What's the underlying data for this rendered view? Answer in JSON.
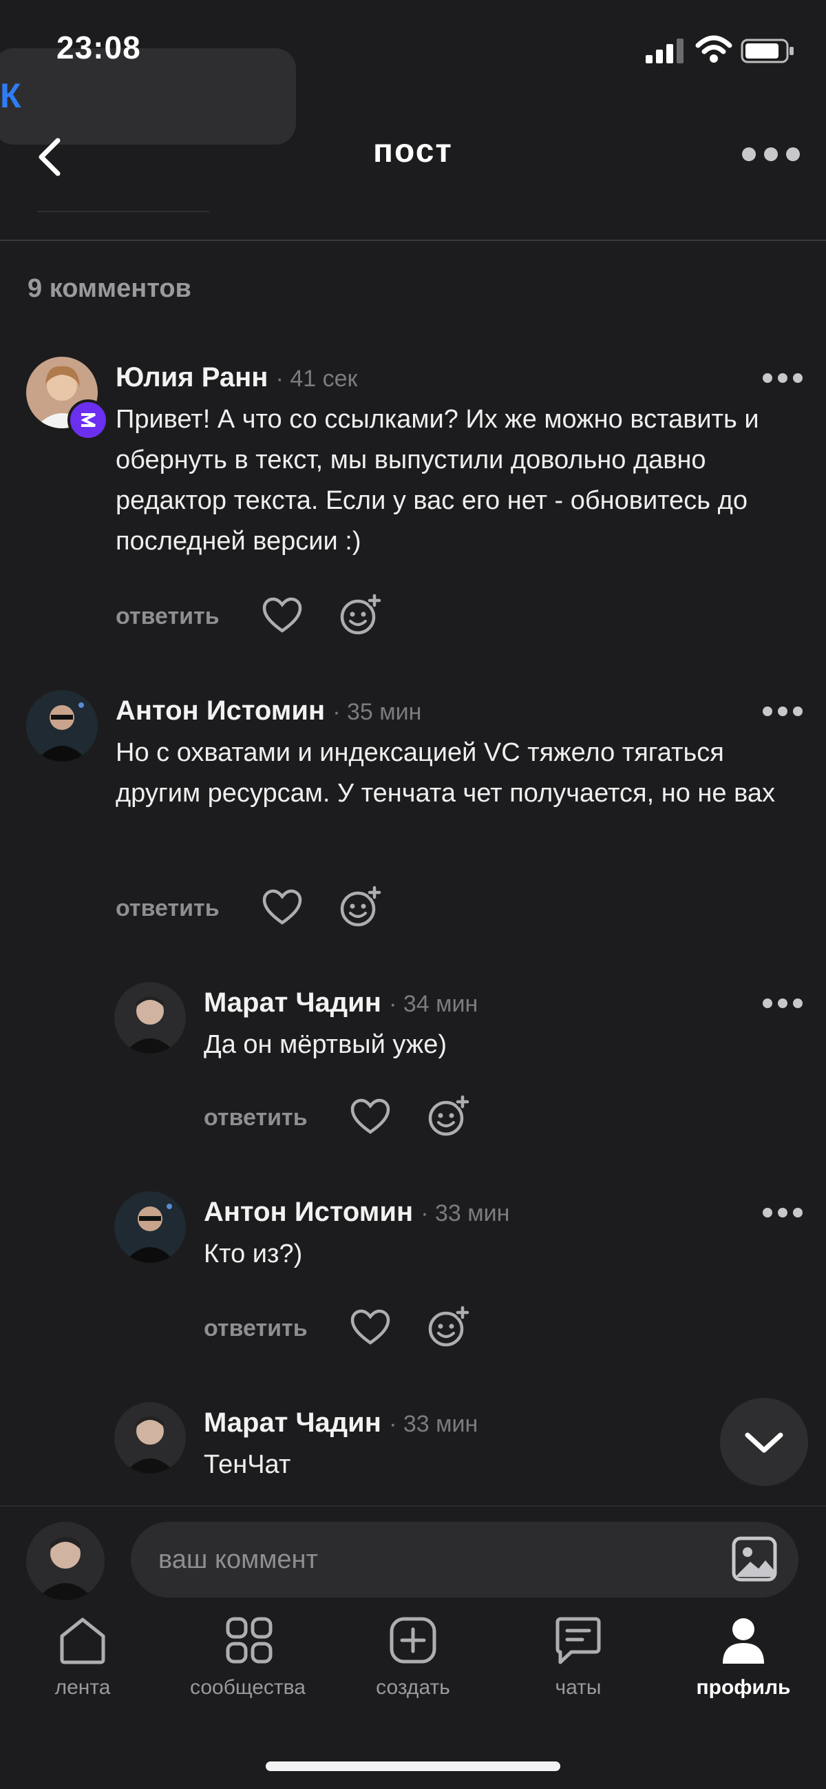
{
  "status_bar": {
    "time": "23:08",
    "battery": "battery-icon",
    "wifi": "wifi-icon",
    "signal": "signal-icon"
  },
  "back_app": {
    "label": "К"
  },
  "header": {
    "title": "пост",
    "back_icon": "chevron-left-icon",
    "more_icon": "more-horizontal-icon"
  },
  "comments_count": "9 комментов",
  "comments": [
    {
      "author": "Юлия Ранн",
      "time": "· 41 сек",
      "text": "Привет! А что со ссылками? Их же можно вставить и обернуть в текст, мы выпустили довольно давно редактор текста. Если у вас его нет - обновитесь до последней версии :)",
      "reply": "ответить"
    },
    {
      "author": "Антон Истомин",
      "time": "· 35 мин",
      "text": "Но с охватами и индексацией VC тяжело тягаться другим ресурсам. У тенчата чет получается, но не вах",
      "reply": "ответить"
    },
    {
      "author": "Марат Чадин",
      "time": "· 34 мин",
      "text": "Да он мёртвый уже)",
      "reply": "ответить"
    },
    {
      "author": "Антон Истомин",
      "time": "· 33 мин",
      "text": "Кто из?)",
      "reply": "ответить"
    },
    {
      "author": "Марат Чадин",
      "time": "· 33 мин",
      "text": "ТенЧат"
    }
  ],
  "comment_input": {
    "placeholder": "ваш коммент"
  },
  "nav": [
    {
      "label": "лента",
      "icon": "home-icon"
    },
    {
      "label": "сообщества",
      "icon": "grid-icon"
    },
    {
      "label": "создать",
      "icon": "plus-square-icon"
    },
    {
      "label": "чаты",
      "icon": "chat-icon"
    },
    {
      "label": "профиль",
      "icon": "profile-icon",
      "active": true
    }
  ],
  "colors": {
    "background": "#1c1c1e",
    "accent": "#2f7df6",
    "badge": "#6b2ff0"
  }
}
